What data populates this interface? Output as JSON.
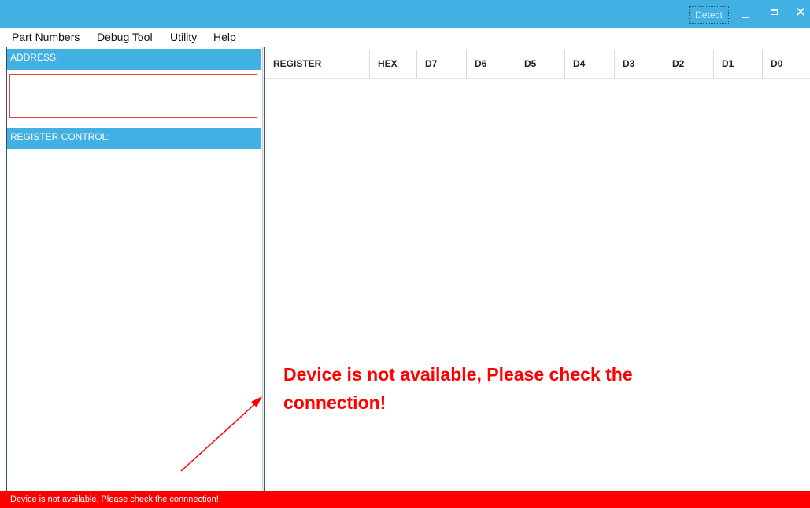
{
  "titlebar": {
    "detect_label": "Detect",
    "accent_color": "#41b0e2"
  },
  "menu": {
    "items": [
      "Part Numbers",
      "Debug Tool",
      "Utility",
      "Help"
    ]
  },
  "left_panel": {
    "address_header": "ADDRESS:",
    "address_value": "",
    "register_control_header": "REGISTER CONTROL:"
  },
  "grid": {
    "columns": [
      "REGISTER",
      "HEX",
      "D7",
      "D6",
      "D5",
      "D4",
      "D3",
      "D2",
      "D1",
      "D0"
    ],
    "rows": []
  },
  "overlay": {
    "line1": "Device is not available, Please check the",
    "line2": "connection!",
    "color": "#ff0000"
  },
  "statusbar": {
    "text": "Device is not available, Please check the connnection!",
    "color": "#ff0000"
  },
  "icons": [
    "minimize-icon",
    "maximize-icon",
    "close-icon",
    "arrow-annotation-icon"
  ]
}
